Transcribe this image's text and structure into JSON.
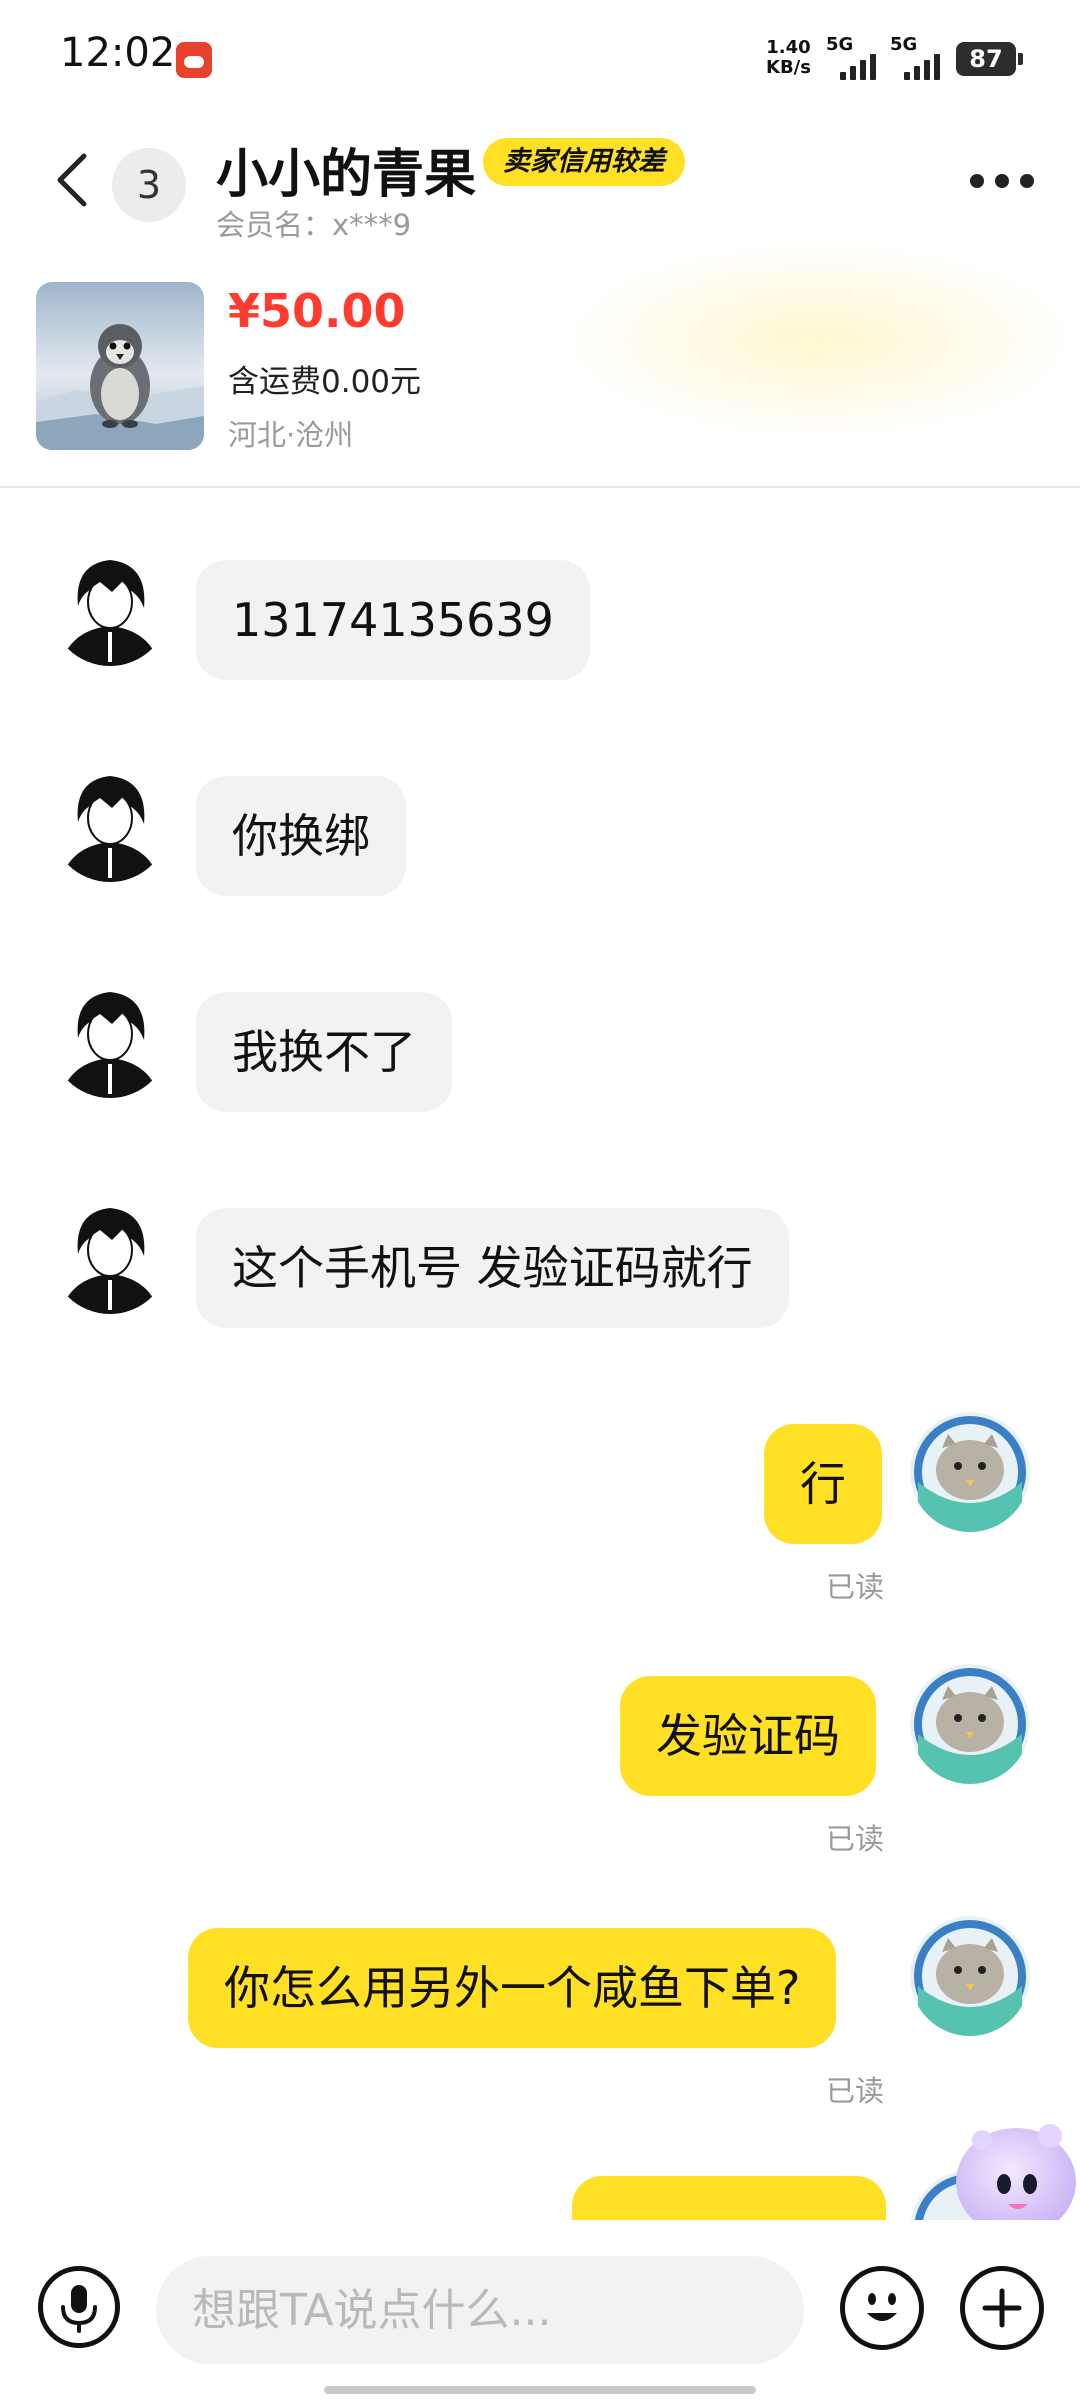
{
  "status_bar": {
    "time": "12:02",
    "net_speed_value": "1.40",
    "net_speed_unit": "KB/s",
    "signal_1_label": "5G",
    "signal_2_label": "5G",
    "battery": "87",
    "app_icon": "app-notification-icon"
  },
  "header": {
    "back_icon": "back-arrow-icon",
    "unread_count": "3",
    "seller_name": "小小的青果",
    "credit_badge": "卖家信用较差",
    "member_label": "会员名：x***9",
    "more_icon": "more-dots-icon"
  },
  "product": {
    "price": "¥50.00",
    "shipping": "含运费0.00元",
    "location": "河北·沧州"
  },
  "messages": [
    {
      "side": "left",
      "text": "13174135639"
    },
    {
      "side": "left",
      "text": "你换绑"
    },
    {
      "side": "left",
      "text": "我换不了"
    },
    {
      "side": "left",
      "text": "这个手机号 发验证码就行"
    },
    {
      "side": "right",
      "text": "行",
      "status": "已读"
    },
    {
      "side": "right",
      "text": "发验证码",
      "status": "已读"
    },
    {
      "side": "right",
      "text": "你怎么用另外一个咸鱼下单?",
      "status": "已读"
    }
  ],
  "input_bar": {
    "placeholder": "想跟TA说点什么...",
    "mic_icon": "microphone-icon",
    "emoji_icon": "emoji-icon",
    "plus_icon": "plus-icon"
  },
  "colors": {
    "accent_yellow": "#ffe024",
    "price_red": "#ff3b30",
    "left_bubble": "#f2f2f4"
  }
}
